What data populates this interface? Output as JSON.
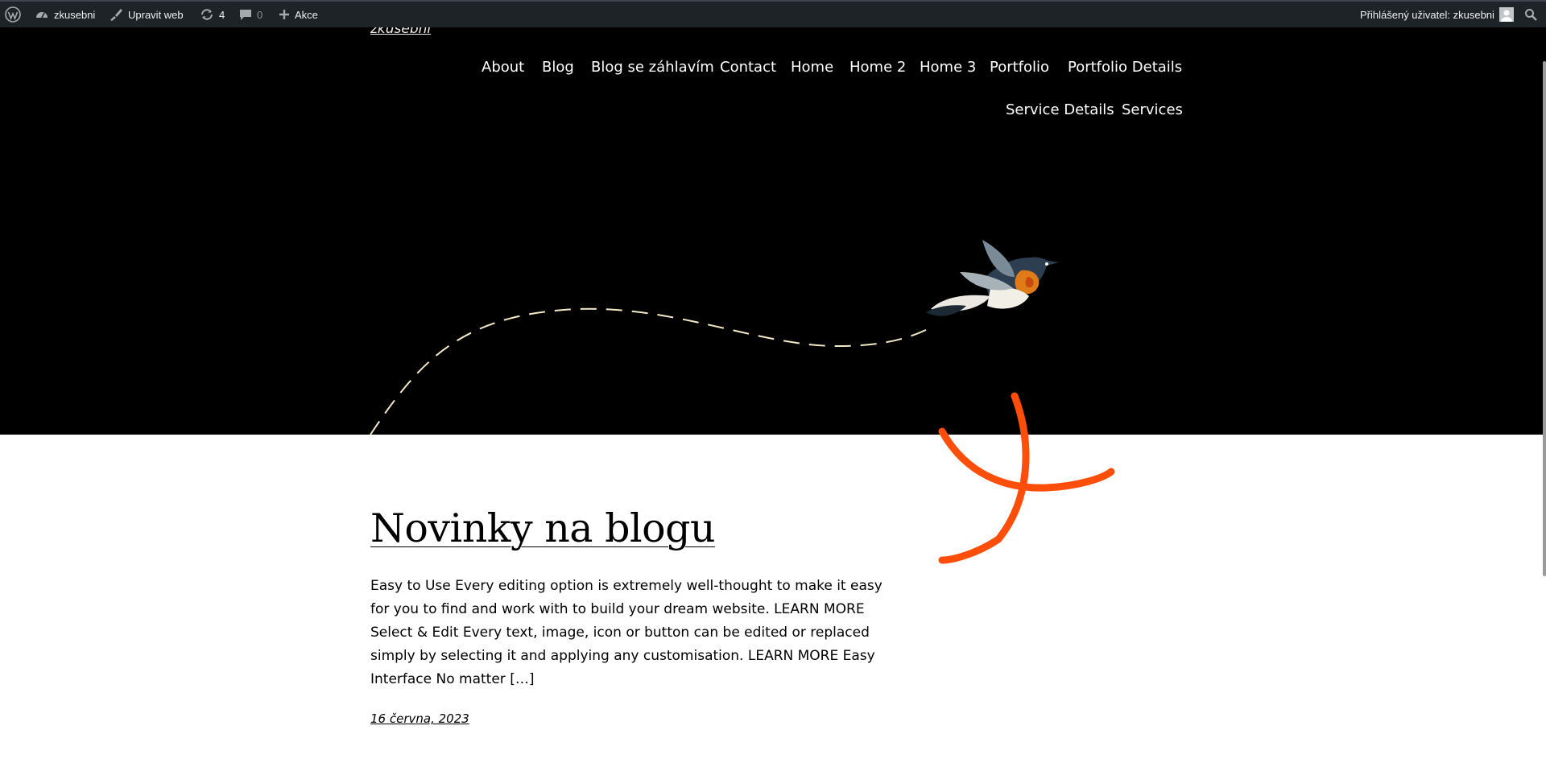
{
  "adminbar": {
    "site_name": "zkusebni",
    "edit_label": "Upravit web",
    "updates_count": "4",
    "comments_count": "0",
    "new_label": "Akce",
    "user_greeting": "Přihlášený uživatel: zkusebni"
  },
  "header": {
    "site_title": "zkusebni",
    "nav": [
      {
        "label": "About"
      },
      {
        "label": "Blog"
      },
      {
        "label": "Blog se záhlavím"
      },
      {
        "label": "Contact"
      },
      {
        "label": "Home"
      },
      {
        "label": "Home 2"
      },
      {
        "label": "Home 3"
      },
      {
        "label": "Portfolio"
      },
      {
        "label": "Portfolio Details"
      },
      {
        "label": "Service Details"
      },
      {
        "label": "Services"
      }
    ]
  },
  "post": {
    "title": "Novinky na blogu",
    "excerpt": "Easy to Use Every editing option is extremely well-thought to make it easy for you to find and work with to build your dream website. LEARN MORE Select & Edit Every text, image, icon or button can be edited or replaced simply by selecting it and applying any customisation. LEARN MORE Easy Interface No matter […]",
    "date": "16 června, 2023"
  },
  "colors": {
    "adminbar_bg": "#1d2327",
    "header_bg": "#000000",
    "accent_orange": "#ff4d0a",
    "dash_line": "#f5e9c8"
  },
  "icons": [
    "wordpress-icon",
    "dashboard-icon",
    "brush-icon",
    "updates-icon",
    "comment-icon",
    "plus-icon",
    "avatar-icon",
    "search-icon",
    "bird-illustration"
  ]
}
